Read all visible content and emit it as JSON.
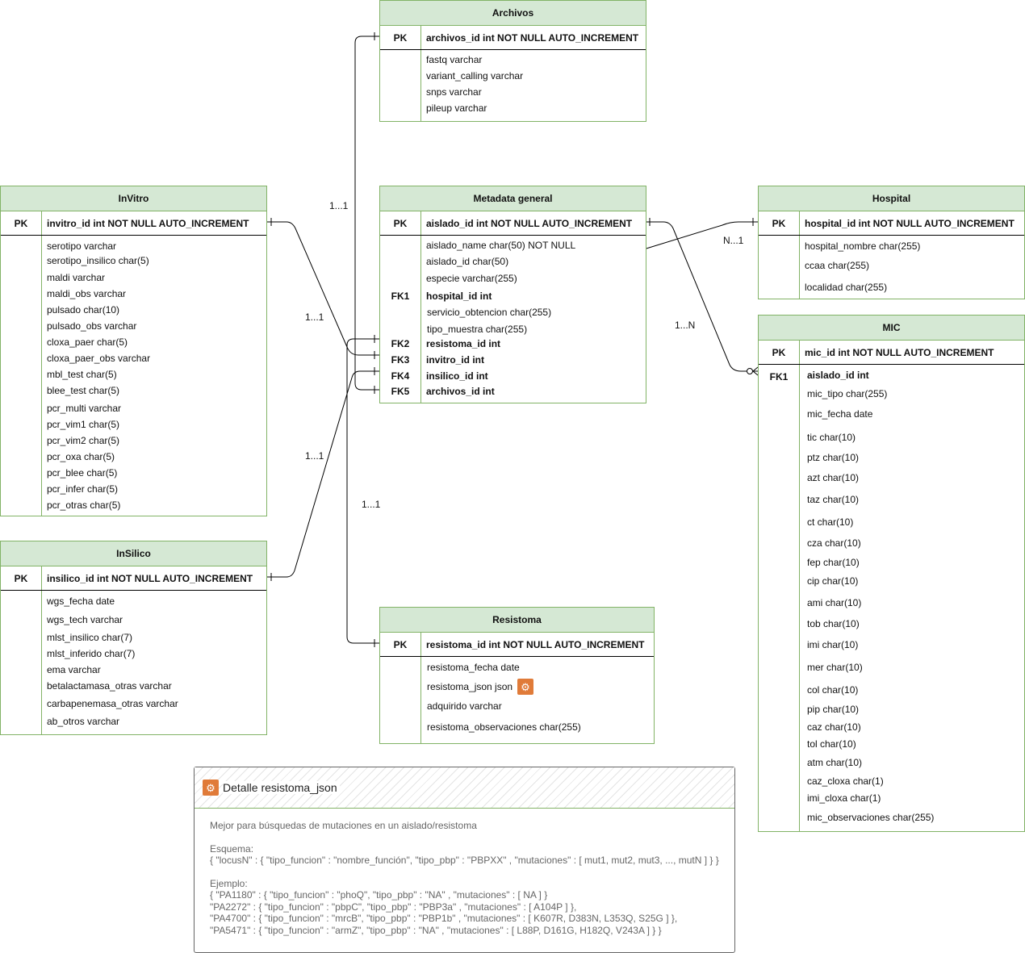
{
  "entities": {
    "archivos": {
      "title": "Archivos",
      "pk_label": "PK",
      "pk_field": "archivos_id int NOT NULL AUTO_INCREMENT",
      "fields": [
        "fastq varchar",
        "variant_calling varchar",
        "snps varchar",
        "pileup varchar"
      ]
    },
    "invitro": {
      "title": "InVitro",
      "pk_label": "PK",
      "pk_field": "invitro_id int NOT NULL AUTO_INCREMENT",
      "fields": [
        "serotipo varchar",
        "serotipo_insilico char(5)",
        "maldi varchar",
        "maldi_obs varchar",
        "pulsado char(10)",
        "pulsado_obs varchar",
        "cloxa_paer char(5)",
        "cloxa_paer_obs varchar",
        "mbl_test char(5)",
        "blee_test char(5)",
        "pcr_multi varchar",
        "pcr_vim1 char(5)",
        "pcr_vim2 char(5)",
        "pcr_oxa char(5)",
        "pcr_blee char(5)",
        "pcr_infer char(5)",
        "pcr_otras char(5)"
      ]
    },
    "metadata": {
      "title": "Metadata general",
      "pk_label": "PK",
      "pk_field": "aislado_id int NOT NULL AUTO_INCREMENT",
      "fields": [
        "aislado_name char(50) NOT NULL",
        "aislado_id char(50)",
        "especie varchar(255)",
        "hospital_id int",
        "servicio_obtencion char(255)",
        "tipo_muestra char(255)",
        "resistoma_id int",
        "invitro_id int",
        "insilico_id int",
        "archivos_id int"
      ],
      "fk_labels": [
        "FK1",
        "FK2",
        "FK3",
        "FK4",
        "FK5"
      ]
    },
    "hospital": {
      "title": "Hospital",
      "pk_label": "PK",
      "pk_field": "hospital_id int NOT NULL AUTO_INCREMENT",
      "fields": [
        "hospital_nombre char(255)",
        "ccaa char(255)",
        "localidad char(255)"
      ]
    },
    "mic": {
      "title": "MIC",
      "pk_label": "PK",
      "pk_field": "mic_id int NOT NULL AUTO_INCREMENT",
      "fk_label": "FK1",
      "fields": [
        "aislado_id int",
        "mic_tipo char(255)",
        "mic_fecha date",
        "tic char(10)",
        "ptz char(10)",
        "azt char(10)",
        "taz char(10)",
        "ct char(10)",
        "cza char(10)",
        "fep char(10)",
        "cip char(10)",
        "ami char(10)",
        "tob char(10)",
        "imi char(10)",
        "mer char(10)",
        "col char(10)",
        "pip char(10)",
        "caz char(10)",
        "tol char(10)",
        "atm char(10)",
        "caz_cloxa char(1)",
        "imi_cloxa char(1)",
        "mic_observaciones char(255)"
      ]
    },
    "insilico": {
      "title": "InSilico",
      "pk_label": "PK",
      "pk_field": "insilico_id int NOT NULL AUTO_INCREMENT",
      "fields": [
        "wgs_fecha date",
        "wgs_tech varchar",
        "mlst_insilico char(7)",
        "mlst_inferido char(7)",
        "ema varchar",
        "betalactamasa_otras varchar",
        "carbapenemasa_otras varchar",
        "ab_otros varchar"
      ]
    },
    "resistoma": {
      "title": "Resistoma",
      "pk_label": "PK",
      "pk_field": "resistoma_id int NOT NULL AUTO_INCREMENT",
      "fields": [
        "resistoma_fecha date",
        "resistoma_json json",
        "adquirido varchar",
        "resistoma_observaciones char(255)"
      ]
    }
  },
  "relations": {
    "archivos": "1...1",
    "invitro": "1...1",
    "insilico": "1...1",
    "resistoma": "1...1",
    "hospital": "N...1",
    "mic": "1...N"
  },
  "note": {
    "title": "Detalle resistoma_json",
    "line1": "Mejor para búsquedas de mutaciones en un aislado/resistoma",
    "schema_label": "Esquema:",
    "schema": "{ \"locusN\" : { \"tipo_funcion\" : \"nombre_función\", \"tipo_pbp\" : \"PBPXX\" , \"mutaciones\" : [ mut1, mut2, mut3, ..., mutN ] } }",
    "example_label": "Ejemplo:",
    "examples": [
      "{ \"PA1180\" : { \"tipo_funcion\" : \"phoQ\", \"tipo_pbp\" : \"NA\" , \"mutaciones\" : [ NA ] }",
      "\"PA2272\" : { \"tipo_funcion\" : \"pbpC\", \"tipo_pbp\" : \"PBP3a\" , \"mutaciones\" : [ A104P ] },",
      "\"PA4700\" : { \"tipo_funcion\" : \"mrcB\", \"tipo_pbp\" : \"PBP1b\" , \"mutaciones\" : [ K607R, D383N, L353Q, S25G ] },",
      "\"PA5471\" : { \"tipo_funcion\" : \"armZ\", \"tipo_pbp\" : \"NA\" , \"mutaciones\" : [ L88P, D161G, H182Q, V243A ] } }"
    ]
  },
  "colors": {
    "header_fill": "#d5e8d4",
    "border": "#82b366",
    "icon": "#e07b39",
    "note_text": "#666666"
  },
  "icons": {
    "json_icon": "gear-icon"
  }
}
